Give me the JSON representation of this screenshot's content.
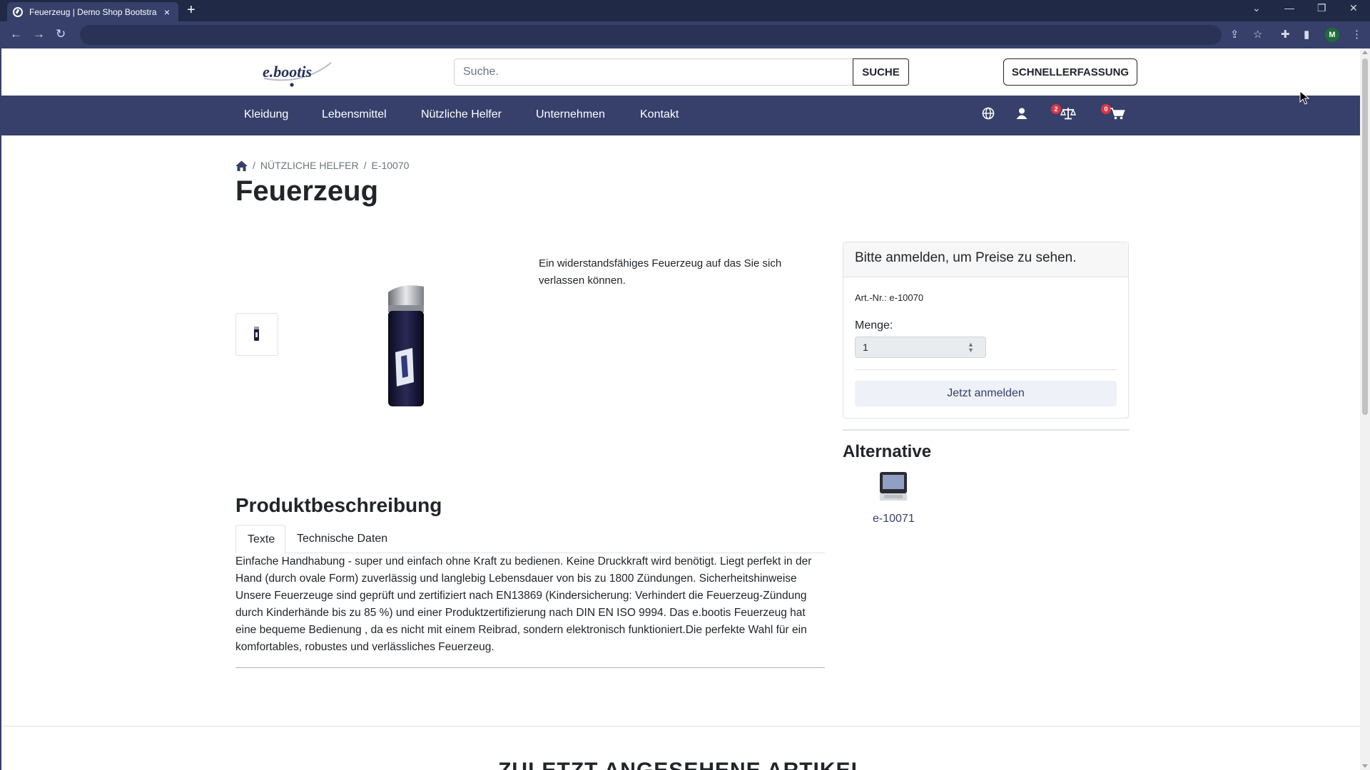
{
  "browser": {
    "tab_title": "Feuerzeug | Demo Shop Bootstrap",
    "tab_close": "×",
    "new_tab": "+",
    "profile_initial": "M"
  },
  "header": {
    "logo_text": "e.bootis",
    "search_placeholder": "Suche.",
    "search_button": "SUCHE",
    "quick_order_button": "SCHNELLERFASSUNG"
  },
  "nav": {
    "items": [
      "Kleidung",
      "Lebensmittel",
      "Nützliche Helfer",
      "Unternehmen",
      "Kontakt"
    ],
    "compare_count": "2",
    "cart_count": "0"
  },
  "breadcrumb": {
    "category": "NÜTZLICHE HELFER",
    "current": "E-10070",
    "separator": "/"
  },
  "product": {
    "title": "Feuerzeug",
    "short_description": "Ein widerstandsfähiges Feuerzeug auf das Sie sich verlassen können.",
    "buy_box": {
      "header": "Bitte anmelden, um Preise zu sehen.",
      "article_number": "Art.-Nr.: e-10070",
      "quantity_label": "Menge:",
      "quantity_value": "1",
      "login_button": "Jetzt anmelden"
    },
    "alternative": {
      "title": "Alternative",
      "item_code": "e-10071"
    },
    "description": {
      "title": "Produktbeschreibung",
      "tabs": [
        "Texte",
        "Technische Daten"
      ],
      "active_tab": "Texte",
      "text": "Einfache Handhabung - super und einfach ohne Kraft zu bedienen. Keine Druckkraft wird benötigt. Liegt perfekt in der Hand (durch ovale Form) zuverlässig und langlebig Lebensdauer von bis zu 1800 Zündungen. Sicherheitshinweise Unsere Feuerzeuge sind geprüft und zertifiziert nach EN13869 (Kindersicherung: Verhindert die Feuerzeug-Zündung durch Kinderhände bis zu 85 %) und einer Produktzertifizierung nach DIN EN ISO 9994. Das e.bootis Feuerzeug hat eine bequeme Bedienung , da es nicht mit einem Reibrad, sondern elektronisch funktioniert.Die perfekte Wahl für ein komfortables, robustes und verlässliches Feuerzeug."
    }
  },
  "recently_viewed": {
    "title": "ZULETZT ANGESEHENE ARTIKEL"
  },
  "colors": {
    "brand_navy": "#36406a",
    "browser_dark": "#202945",
    "badge_red": "#dc3545"
  }
}
